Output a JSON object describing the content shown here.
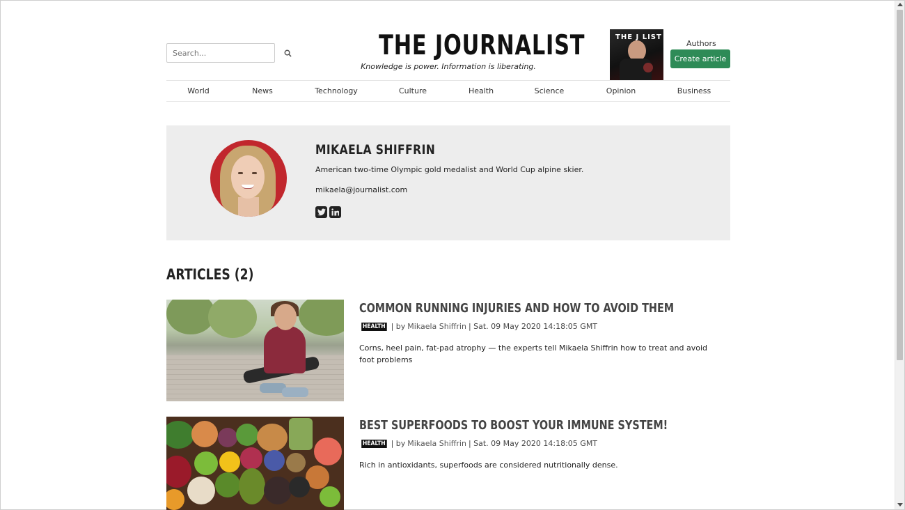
{
  "header": {
    "search_placeholder": "Search...",
    "search_icon": "search-icon",
    "logo_title": "THE JOURNALIST",
    "logo_tagline": "Knowledge is power. Information is liberating.",
    "magazine_cover_text": "THE J    LIST",
    "authors_link": "Authors",
    "create_button": "Create article",
    "accent_color": "#2e8b57"
  },
  "nav": {
    "items": [
      {
        "label": "World"
      },
      {
        "label": "News"
      },
      {
        "label": "Technology"
      },
      {
        "label": "Culture"
      },
      {
        "label": "Health"
      },
      {
        "label": "Science"
      },
      {
        "label": "Opinion"
      },
      {
        "label": "Business"
      }
    ]
  },
  "author": {
    "name": "MIKAELA SHIFFRIN",
    "bio": "American two-time Olympic gold medalist and World Cup alpine skier.",
    "email": "mikaela@journalist.com",
    "social": [
      "twitter-icon",
      "linkedin-icon"
    ]
  },
  "articles": {
    "heading": "ARTICLES (2)",
    "items": [
      {
        "title": "COMMON RUNNING INJURIES AND HOW TO AVOID THEM",
        "tag": "HEALTH",
        "by": "| by",
        "author": "Mikaela Shiffrin",
        "date": "| Sat. 09 May 2020 14:18:05 GMT",
        "summary": "Corns, heel pain, fat-pad atrophy — the experts tell Mikaela Shiffrin how to treat and avoid foot problems"
      },
      {
        "title": "BEST SUPERFOODS TO BOOST YOUR IMMUNE SYSTEM!",
        "tag": "HEALTH",
        "by": "| by",
        "author": "Mikaela Shiffrin",
        "date": "| Sat. 09 May 2020 14:18:05 GMT",
        "summary": "Rich in antioxidants, superfoods are considered nutritionally dense."
      }
    ]
  }
}
